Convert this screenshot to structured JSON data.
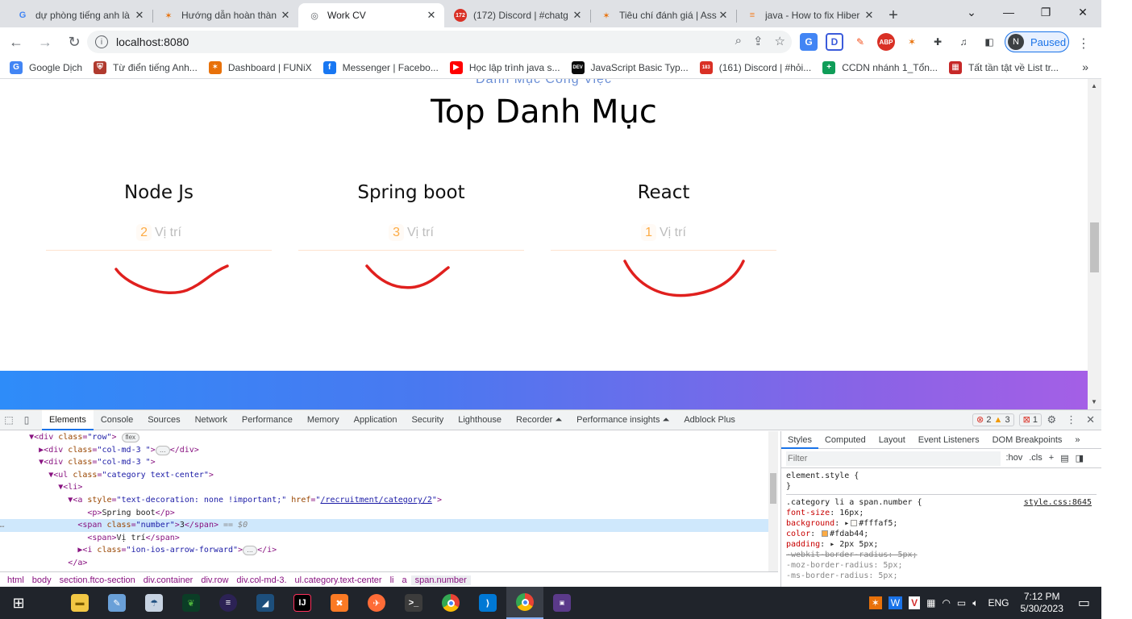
{
  "browser": {
    "tabs": [
      {
        "title": "dự phòng tiếng anh là",
        "icon_color": "#4285f4",
        "icon_letter": "G"
      },
      {
        "title": "Hướng dẫn hoàn thàn",
        "icon_color": "#e8710a",
        "icon_letter": "✶"
      },
      {
        "title": "Work CV",
        "icon_color": "#5f6368",
        "icon_letter": "◎",
        "active": true
      },
      {
        "title": "(172) Discord | #chatg",
        "icon_color": "#d93025",
        "icon_letter": "172"
      },
      {
        "title": "Tiêu chí đánh giá | Ass",
        "icon_color": "#e8710a",
        "icon_letter": "✶"
      },
      {
        "title": "java - How to fix Hiber",
        "icon_color": "#f48024",
        "icon_letter": "≡"
      }
    ],
    "tab_close": "✕",
    "new_tab": "+",
    "address": "localhost:8080",
    "profile_initial": "N",
    "profile_status": "Paused"
  },
  "bookmarks": [
    {
      "label": "Google Dịch",
      "color": "#4285f4",
      "glyph": "G"
    },
    {
      "label": "Từ điển tiếng Anh...",
      "color": "#b03a2e",
      "glyph": "⛨"
    },
    {
      "label": "Dashboard | FUNiX",
      "color": "#e8710a",
      "glyph": "✶"
    },
    {
      "label": "Messenger | Facebo...",
      "color": "#1877f2",
      "glyph": "f"
    },
    {
      "label": "Học lập trình java s...",
      "color": "#ff0000",
      "glyph": "▶"
    },
    {
      "label": "JavaScript Basic Typ...",
      "color": "#0a0a0a",
      "glyph": "DEV"
    },
    {
      "label": "(161) Discord | #hỏi...",
      "color": "#d93025",
      "glyph": "183"
    },
    {
      "label": "CCDN nhánh 1_Tổn...",
      "color": "#0f9d58",
      "glyph": "+"
    },
    {
      "label": "Tất tần tật về List tr...",
      "color": "#c62828",
      "glyph": "▦"
    }
  ],
  "page": {
    "subheading": "Danh Mục Công Việc",
    "title": "Top Danh Mục",
    "categories": [
      {
        "name": "Node Js",
        "count": "2",
        "unit": "Vị trí"
      },
      {
        "name": "Spring boot",
        "count": "3",
        "unit": "Vị trí"
      },
      {
        "name": "React",
        "count": "1",
        "unit": "Vị trí"
      }
    ],
    "scribble_color": "#e0201e"
  },
  "devtools": {
    "tabs": [
      "Elements",
      "Console",
      "Sources",
      "Network",
      "Performance",
      "Memory",
      "Application",
      "Security",
      "Lighthouse",
      "Recorder ⏶",
      "Performance insights ⏶",
      "Adblock Plus"
    ],
    "errors": "2",
    "warnings": "3",
    "issues": "1",
    "flex_badge": "flex",
    "breadcrumbs": [
      "html",
      "body",
      "section.ftco-section",
      "div.container",
      "div.row",
      "div.col-md-3.",
      "ul.category.text-center",
      "li",
      "a",
      "span.number"
    ],
    "style_tabs": [
      "Styles",
      "Computed",
      "Layout",
      "Event Listeners",
      "DOM Breakpoints"
    ],
    "filter_placeholder": "Filter",
    "filter_tools": [
      ":hov",
      ".cls",
      "+"
    ],
    "element_style": "element.style {",
    "rule_selector": ".category li a span.number {",
    "rule_source": "style.css:8645",
    "props": {
      "font_size": "16px;",
      "background": "#fffaf5;",
      "color": "#fdab44;",
      "padding": "2px 5px;",
      "webkit_radius": "-webkit-border-radius: 5px;",
      "moz_radius": "-moz-border-radius: 5px;",
      "ms_radius": "-ms-border-radius: 5px;"
    },
    "code": {
      "href_value": "/recruitment/category/2",
      "p_text": "Spring boot",
      "span_number": "3",
      "span_text": "Vị trí",
      "sel_marker": "== $0"
    }
  },
  "taskbar": {
    "language": "ENG",
    "time": "7:12 PM",
    "date": "5/30/2023"
  }
}
